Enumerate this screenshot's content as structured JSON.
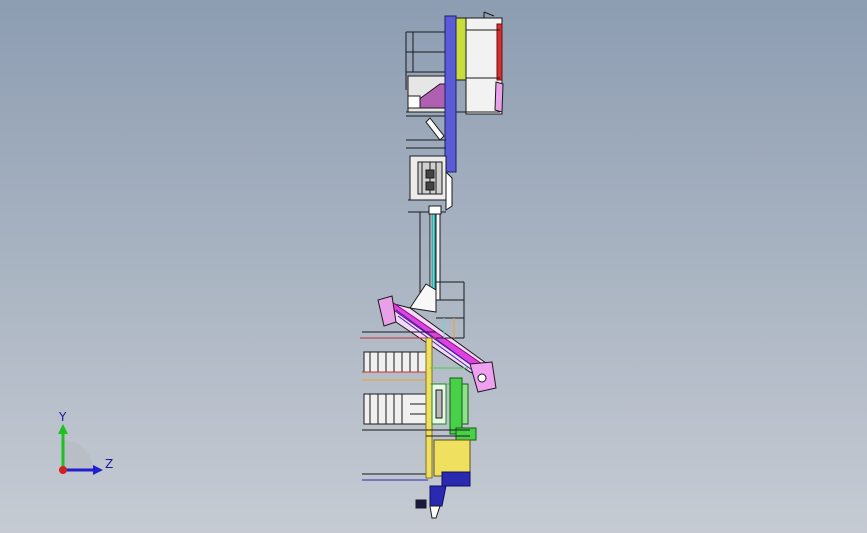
{
  "viewport": {
    "background_top": "#8d9db2",
    "background_bottom": "#c6cbd3"
  },
  "model": {
    "colors": {
      "outline": "#1a1a1a",
      "blue_column": "#5b5bd6",
      "yellow_green": "#c8dc3c",
      "magenta": "#e040e0",
      "pink_light": "#e8a0e8",
      "green": "#48d048",
      "yellow": "#f0e060",
      "cyan": "#60d8d8",
      "orange": "#f0a030",
      "red": "#d03030",
      "grey": "#d8d8d8",
      "dark_blue": "#2a2ab0"
    }
  },
  "triad": {
    "y_label": "Y",
    "z_label": "Z",
    "y_color": "#20c020",
    "z_color": "#2020d0",
    "x_color": "#d02020"
  }
}
